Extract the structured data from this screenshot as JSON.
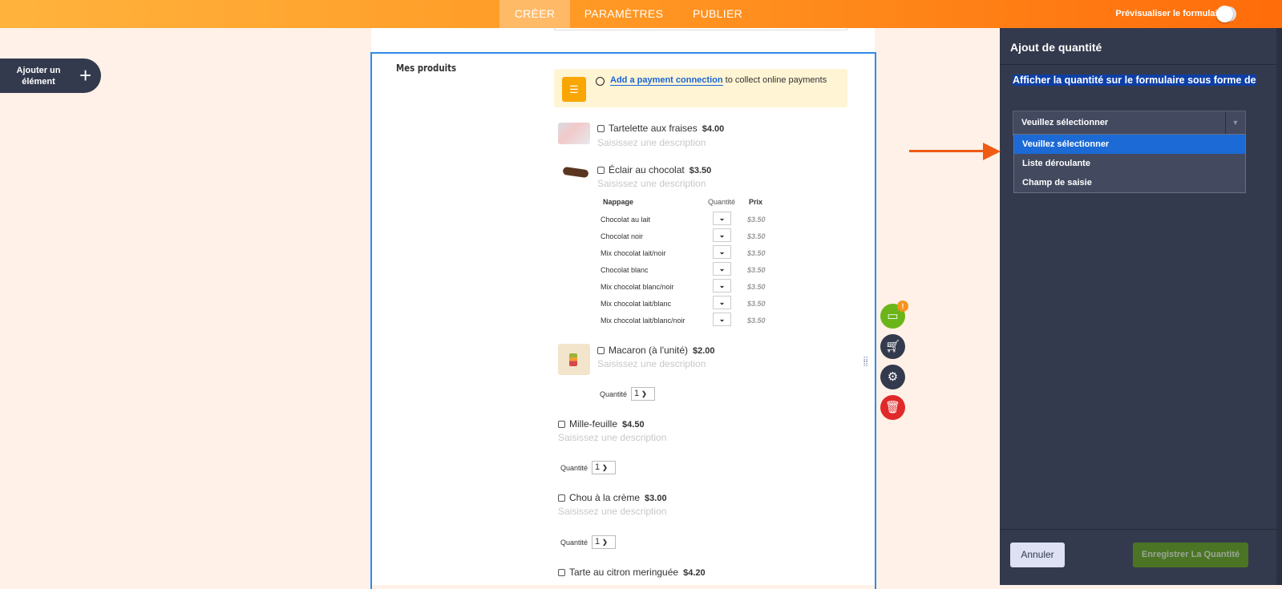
{
  "topbar": {
    "tabs": [
      {
        "label": "CRÉER",
        "active": true
      },
      {
        "label": "PARAMÈTRES",
        "active": false
      },
      {
        "label": "PUBLIER",
        "active": false
      }
    ],
    "preview_label": "Prévisualiser le formulaire",
    "preview_on": false
  },
  "add_element": {
    "label": "Ajouter un élément",
    "icon": "plus-icon"
  },
  "form": {
    "field_label": "Mes produits",
    "notice": {
      "link": "Add a payment connection",
      "text": " to collect online payments"
    },
    "products": [
      {
        "name": "Tartelette aux fraises",
        "price": "$4.00",
        "desc": "Saisissez une description"
      },
      {
        "name": "Éclair au chocolat",
        "price": "$3.50",
        "desc": "Saisissez une description"
      },
      {
        "name": "Macaron (à l'unité)",
        "price": "$2.00",
        "desc": "Saisissez une description",
        "qty_label": "Quantité",
        "qty": "1"
      },
      {
        "name": "Mille-feuille",
        "price": "$4.50",
        "desc": "Saisissez une description",
        "qty_label": "Quantité",
        "qty": "1"
      },
      {
        "name": "Chou à la crème",
        "price": "$3.00",
        "desc": "Saisissez une description",
        "qty_label": "Quantité",
        "qty": "1"
      },
      {
        "name": "Tarte au citron meringuée",
        "price": "$4.20"
      }
    ],
    "options_table": {
      "headers": [
        "Nappage",
        "Quantité",
        "Prix"
      ],
      "rows": [
        {
          "name": "Chocolat au lait",
          "price": "$3.50"
        },
        {
          "name": "Chocolat noir",
          "price": "$3.50"
        },
        {
          "name": "Mix chocolat lait/noir",
          "price": "$3.50"
        },
        {
          "name": "Chocolat blanc",
          "price": "$3.50"
        },
        {
          "name": "Mix chocolat blanc/noir",
          "price": "$3.50"
        },
        {
          "name": "Mix chocolat lait/blanc",
          "price": "$3.50"
        },
        {
          "name": "Mix chocolat lait/blanc/noir",
          "price": "$3.50"
        }
      ]
    },
    "badge": "!"
  },
  "panel": {
    "title": "Ajout de quantité",
    "question": "Afficher la quantité sur le formulaire sous forme de",
    "selected": "Veuillez sélectionner",
    "options": [
      "Veuillez sélectionner",
      "Liste déroulante",
      "Champ de saisie"
    ],
    "cancel": "Annuler",
    "save": "Enregistrer La Quantité"
  },
  "colors": {
    "accent": "#ff6c0a",
    "panel": "#343a4d",
    "highlight": "#1b6ad6",
    "save": "#4b7524"
  }
}
